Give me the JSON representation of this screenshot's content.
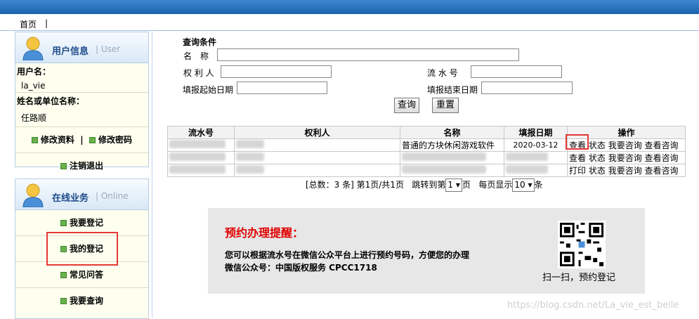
{
  "nav": {
    "home": "首页",
    "sep": "|"
  },
  "user_panel": {
    "title": "用户信息",
    "title_en": "| User",
    "username_label": "用户名：",
    "username": "la_vie",
    "name_label": "姓名或单位名称：",
    "name": "任路顺",
    "edit_profile": "修改资料",
    "divider": "|",
    "change_password": "修改密码",
    "logout": "注销退出"
  },
  "business_panel": {
    "title": "在线业务",
    "title_en": "| Online",
    "items": [
      "我要登记",
      "我的登记",
      "常见问答",
      "我要查询"
    ]
  },
  "query": {
    "section_title": "查询条件",
    "name_label": "名　称",
    "owner_label": "权 利 人",
    "serial_label": "流 水 号",
    "start_date_label": "填报起始日期",
    "end_date_label": "填报结束日期",
    "search_button": "查询",
    "reset_button": "重置"
  },
  "table": {
    "headers": [
      "流水号",
      "权利人",
      "名称",
      "填报日期",
      "操作"
    ],
    "rows": [
      {
        "name": "普通的方块休闲游戏软件",
        "date": "2020-03-12",
        "actions": [
          "查看",
          "状态",
          "我要咨询",
          "查看咨询"
        ]
      },
      {
        "name": "",
        "date": "",
        "actions": [
          "查看",
          "状态",
          "我要咨询",
          "查看咨询"
        ]
      },
      {
        "name": "",
        "date": "",
        "actions": [
          "打印",
          "状态",
          "我要咨询",
          "查看咨询"
        ]
      }
    ]
  },
  "pager": {
    "total_text": "[总数：3 条] 第1页/共1页",
    "jump_label": "跳转到第",
    "page_value": "1",
    "page_unit": "页",
    "per_page_label": "每页显示",
    "per_page_value": "10",
    "per_page_unit": "条"
  },
  "notice": {
    "title": "预约办理提醒：",
    "line1": "您可以根据流水号在微信公众平台上进行预约号码，方便您的办理",
    "line2": "微信公众号：中国版权服务 CPCC1718",
    "qr_caption": "扫一扫，预约登记"
  },
  "watermark": "https://blog.csdn.net/La_vie_est_belle",
  "colors": {
    "accent": "#1a62ad",
    "notice_title": "#e00000",
    "highlight_box": "#e53935"
  }
}
